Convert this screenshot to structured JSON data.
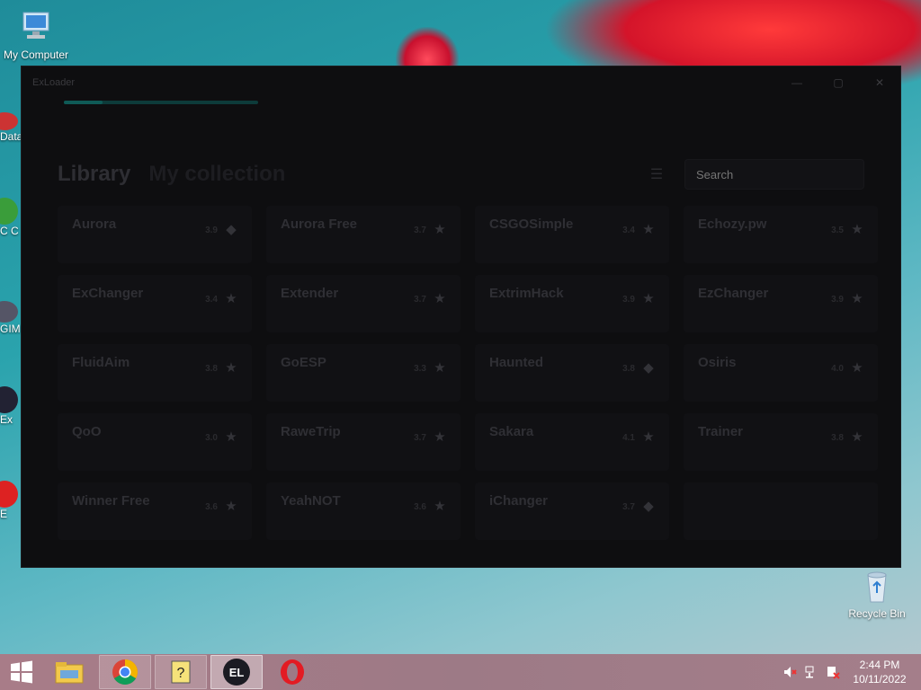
{
  "desktop": {
    "icons": [
      {
        "label": "My Computer"
      },
      {
        "label": "Recycle Bin"
      }
    ],
    "edge_labels": [
      "Data",
      "C\nC",
      "GIM",
      "Ex",
      "E"
    ]
  },
  "window": {
    "title": "ExLoader",
    "controls": {
      "minimize": "—",
      "maximize": "▢",
      "close": "✕"
    },
    "progress": 0.2,
    "tabs": {
      "library": "Library",
      "collection": "My collection"
    },
    "search": {
      "placeholder": "Search"
    },
    "cards": [
      {
        "name": "Aurora",
        "rating": "3.9",
        "icon": "tag-icon"
      },
      {
        "name": "Aurora Free",
        "rating": "3.7",
        "icon": "star-icon"
      },
      {
        "name": "CSGOSimple",
        "rating": "3.4",
        "icon": "star-icon"
      },
      {
        "name": "Echozy.pw",
        "rating": "3.5",
        "icon": "star-icon"
      },
      {
        "name": "ExChanger",
        "rating": "3.4",
        "icon": "star-icon"
      },
      {
        "name": "Extender",
        "rating": "3.7",
        "icon": "star-icon"
      },
      {
        "name": "ExtrimHack",
        "rating": "3.9",
        "icon": "star-icon"
      },
      {
        "name": "EzChanger",
        "rating": "3.9",
        "icon": "star-icon"
      },
      {
        "name": "FluidAim",
        "rating": "3.8",
        "icon": "star-icon"
      },
      {
        "name": "GoESP",
        "rating": "3.3",
        "icon": "star-icon"
      },
      {
        "name": "Haunted",
        "rating": "3.8",
        "icon": "tag-icon"
      },
      {
        "name": "Osiris",
        "rating": "4.0",
        "icon": "star-icon"
      },
      {
        "name": "QoO",
        "rating": "3.0",
        "icon": "star-icon"
      },
      {
        "name": "RaweTrip",
        "rating": "3.7",
        "icon": "star-icon"
      },
      {
        "name": "Sakara",
        "rating": "4.1",
        "icon": "star-icon"
      },
      {
        "name": "Trainer",
        "rating": "3.8",
        "icon": "star-icon"
      },
      {
        "name": "Winner Free",
        "rating": "3.6",
        "icon": "star-icon"
      },
      {
        "name": "YeahNOT",
        "rating": "3.6",
        "icon": "star-icon"
      },
      {
        "name": "iChanger",
        "rating": "3.7",
        "icon": "tag-icon"
      },
      {
        "name": "",
        "rating": "",
        "icon": ""
      }
    ]
  },
  "taskbar": {
    "apps": [
      "file-explorer-icon",
      "chrome-icon",
      "help-icon",
      "exloader-icon",
      "opera-icon"
    ],
    "clock": {
      "time": "2:44 PM",
      "date": "10/11/2022"
    }
  }
}
